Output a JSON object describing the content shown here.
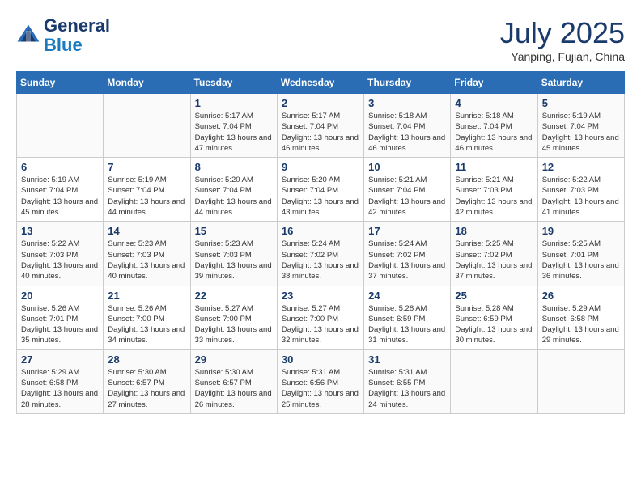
{
  "logo": {
    "line1": "General",
    "line2": "Blue"
  },
  "title": "July 2025",
  "location": "Yanping, Fujian, China",
  "days_of_week": [
    "Sunday",
    "Monday",
    "Tuesday",
    "Wednesday",
    "Thursday",
    "Friday",
    "Saturday"
  ],
  "weeks": [
    [
      {
        "date": "",
        "info": ""
      },
      {
        "date": "",
        "info": ""
      },
      {
        "date": "1",
        "sunrise": "5:17 AM",
        "sunset": "7:04 PM",
        "daylight": "13 hours and 47 minutes."
      },
      {
        "date": "2",
        "sunrise": "5:17 AM",
        "sunset": "7:04 PM",
        "daylight": "13 hours and 46 minutes."
      },
      {
        "date": "3",
        "sunrise": "5:18 AM",
        "sunset": "7:04 PM",
        "daylight": "13 hours and 46 minutes."
      },
      {
        "date": "4",
        "sunrise": "5:18 AM",
        "sunset": "7:04 PM",
        "daylight": "13 hours and 46 minutes."
      },
      {
        "date": "5",
        "sunrise": "5:19 AM",
        "sunset": "7:04 PM",
        "daylight": "13 hours and 45 minutes."
      }
    ],
    [
      {
        "date": "6",
        "sunrise": "5:19 AM",
        "sunset": "7:04 PM",
        "daylight": "13 hours and 45 minutes."
      },
      {
        "date": "7",
        "sunrise": "5:19 AM",
        "sunset": "7:04 PM",
        "daylight": "13 hours and 44 minutes."
      },
      {
        "date": "8",
        "sunrise": "5:20 AM",
        "sunset": "7:04 PM",
        "daylight": "13 hours and 44 minutes."
      },
      {
        "date": "9",
        "sunrise": "5:20 AM",
        "sunset": "7:04 PM",
        "daylight": "13 hours and 43 minutes."
      },
      {
        "date": "10",
        "sunrise": "5:21 AM",
        "sunset": "7:04 PM",
        "daylight": "13 hours and 42 minutes."
      },
      {
        "date": "11",
        "sunrise": "5:21 AM",
        "sunset": "7:03 PM",
        "daylight": "13 hours and 42 minutes."
      },
      {
        "date": "12",
        "sunrise": "5:22 AM",
        "sunset": "7:03 PM",
        "daylight": "13 hours and 41 minutes."
      }
    ],
    [
      {
        "date": "13",
        "sunrise": "5:22 AM",
        "sunset": "7:03 PM",
        "daylight": "13 hours and 40 minutes."
      },
      {
        "date": "14",
        "sunrise": "5:23 AM",
        "sunset": "7:03 PM",
        "daylight": "13 hours and 40 minutes."
      },
      {
        "date": "15",
        "sunrise": "5:23 AM",
        "sunset": "7:03 PM",
        "daylight": "13 hours and 39 minutes."
      },
      {
        "date": "16",
        "sunrise": "5:24 AM",
        "sunset": "7:02 PM",
        "daylight": "13 hours and 38 minutes."
      },
      {
        "date": "17",
        "sunrise": "5:24 AM",
        "sunset": "7:02 PM",
        "daylight": "13 hours and 37 minutes."
      },
      {
        "date": "18",
        "sunrise": "5:25 AM",
        "sunset": "7:02 PM",
        "daylight": "13 hours and 37 minutes."
      },
      {
        "date": "19",
        "sunrise": "5:25 AM",
        "sunset": "7:01 PM",
        "daylight": "13 hours and 36 minutes."
      }
    ],
    [
      {
        "date": "20",
        "sunrise": "5:26 AM",
        "sunset": "7:01 PM",
        "daylight": "13 hours and 35 minutes."
      },
      {
        "date": "21",
        "sunrise": "5:26 AM",
        "sunset": "7:00 PM",
        "daylight": "13 hours and 34 minutes."
      },
      {
        "date": "22",
        "sunrise": "5:27 AM",
        "sunset": "7:00 PM",
        "daylight": "13 hours and 33 minutes."
      },
      {
        "date": "23",
        "sunrise": "5:27 AM",
        "sunset": "7:00 PM",
        "daylight": "13 hours and 32 minutes."
      },
      {
        "date": "24",
        "sunrise": "5:28 AM",
        "sunset": "6:59 PM",
        "daylight": "13 hours and 31 minutes."
      },
      {
        "date": "25",
        "sunrise": "5:28 AM",
        "sunset": "6:59 PM",
        "daylight": "13 hours and 30 minutes."
      },
      {
        "date": "26",
        "sunrise": "5:29 AM",
        "sunset": "6:58 PM",
        "daylight": "13 hours and 29 minutes."
      }
    ],
    [
      {
        "date": "27",
        "sunrise": "5:29 AM",
        "sunset": "6:58 PM",
        "daylight": "13 hours and 28 minutes."
      },
      {
        "date": "28",
        "sunrise": "5:30 AM",
        "sunset": "6:57 PM",
        "daylight": "13 hours and 27 minutes."
      },
      {
        "date": "29",
        "sunrise": "5:30 AM",
        "sunset": "6:57 PM",
        "daylight": "13 hours and 26 minutes."
      },
      {
        "date": "30",
        "sunrise": "5:31 AM",
        "sunset": "6:56 PM",
        "daylight": "13 hours and 25 minutes."
      },
      {
        "date": "31",
        "sunrise": "5:31 AM",
        "sunset": "6:55 PM",
        "daylight": "13 hours and 24 minutes."
      },
      {
        "date": "",
        "info": ""
      },
      {
        "date": "",
        "info": ""
      }
    ]
  ]
}
